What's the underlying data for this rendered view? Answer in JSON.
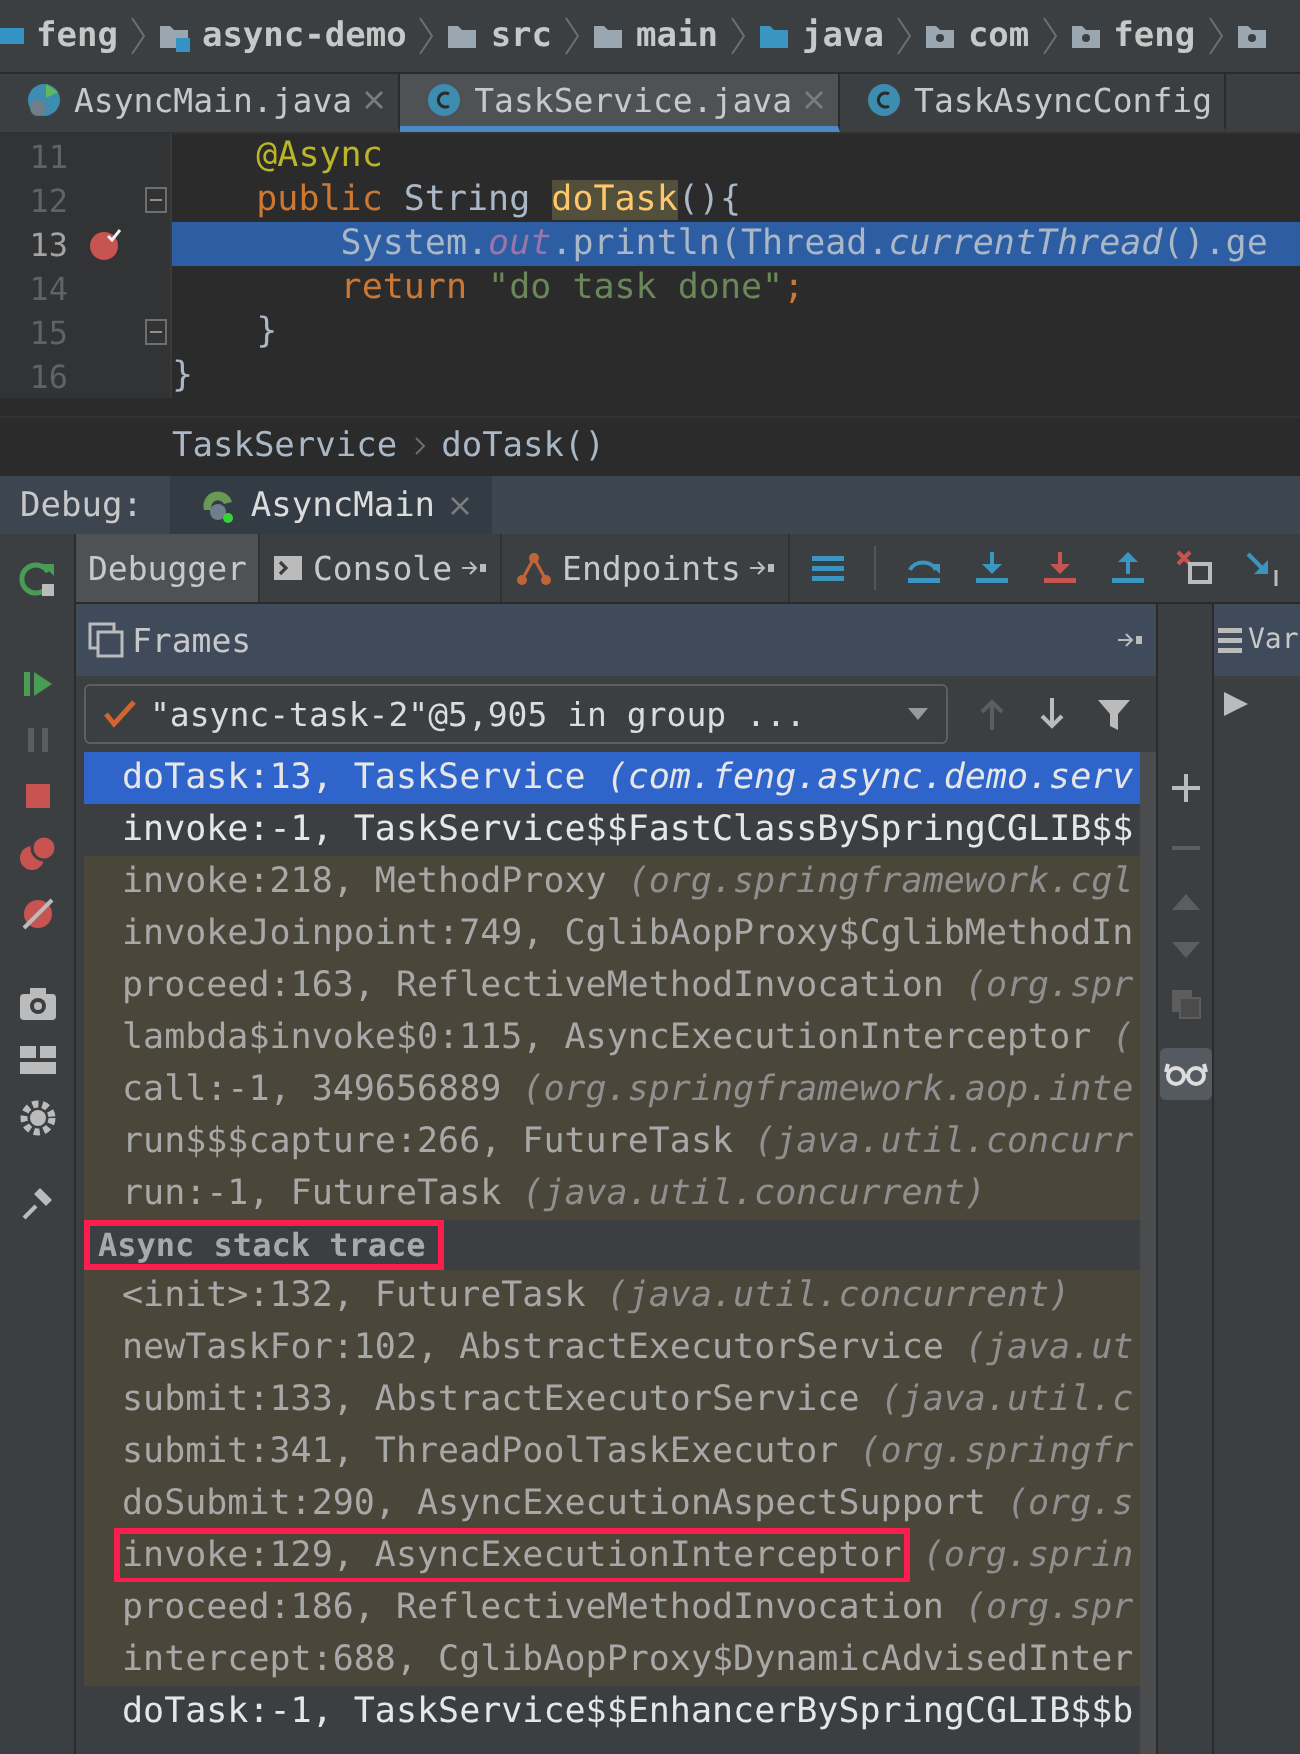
{
  "breadcrumb": [
    {
      "label": "feng",
      "kind": "module"
    },
    {
      "label": "async-demo",
      "kind": "module-folder"
    },
    {
      "label": "src",
      "kind": "folder"
    },
    {
      "label": "main",
      "kind": "folder"
    },
    {
      "label": "java",
      "kind": "source-folder"
    },
    {
      "label": "com",
      "kind": "package"
    },
    {
      "label": "feng",
      "kind": "package"
    }
  ],
  "editor_tabs": [
    {
      "label": "AsyncMain.java",
      "kind": "main-class",
      "selected": false,
      "closable": true
    },
    {
      "label": "TaskService.java",
      "kind": "class",
      "selected": true,
      "closable": true
    },
    {
      "label": "TaskAsyncConfig",
      "kind": "class",
      "selected": false,
      "closable": false
    }
  ],
  "code_lines": [
    {
      "number": "11",
      "current": false,
      "breakpoint": false,
      "fold": false,
      "tokens": [
        {
          "text": "    @Async",
          "kind": "annotation"
        }
      ]
    },
    {
      "number": "12",
      "current": false,
      "breakpoint": false,
      "fold": true,
      "tokens": [
        {
          "text": "    public",
          "kind": "keyword"
        },
        {
          "text": " String ",
          "kind": "plain"
        },
        {
          "text": "doTask",
          "kind": "usage"
        },
        {
          "text": "(){",
          "kind": "plain"
        }
      ]
    },
    {
      "number": "13",
      "current": true,
      "breakpoint": true,
      "fold": false,
      "tokens": [
        {
          "text": "        System.",
          "kind": "plain"
        },
        {
          "text": "out",
          "kind": "field"
        },
        {
          "text": ".println(Thread.",
          "kind": "plain"
        },
        {
          "text": "currentThread",
          "kind": "static"
        },
        {
          "text": "().ge",
          "kind": "plain"
        }
      ]
    },
    {
      "number": "14",
      "current": false,
      "breakpoint": false,
      "fold": false,
      "tokens": [
        {
          "text": "        return",
          "kind": "keyword"
        },
        {
          "text": " \"do task done\"",
          "kind": "string"
        },
        {
          "text": ";",
          "kind": "keyword"
        }
      ]
    },
    {
      "number": "15",
      "current": false,
      "breakpoint": false,
      "fold": true,
      "tokens": [
        {
          "text": "    }",
          "kind": "plain"
        }
      ]
    },
    {
      "number": "16",
      "current": false,
      "breakpoint": false,
      "fold": false,
      "tokens": [
        {
          "text": "}",
          "kind": "plain"
        }
      ]
    }
  ],
  "editor_breadcrumb": [
    "TaskService",
    "doTask()"
  ],
  "debug": {
    "label": "Debug:",
    "session": "AsyncMain"
  },
  "debugger_tabs": [
    {
      "label": "Debugger",
      "kind": "debugger",
      "selected": true
    },
    {
      "label": "Console",
      "kind": "console",
      "selected": false
    },
    {
      "label": "Endpoints",
      "kind": "endpoints",
      "selected": false
    }
  ],
  "frames": {
    "title": "Frames",
    "thread": "\"async-task-2\"@5,905 in group ...",
    "rows": [
      {
        "kind": "frame",
        "name": "doTask:13, TaskService",
        "package": "(com.feng.async.demo.serv",
        "library": false,
        "selected": true
      },
      {
        "kind": "frame",
        "name": "invoke:-1, TaskService$$FastClassBySpringCGLIB$$",
        "library": false,
        "selected": false
      },
      {
        "kind": "frame",
        "name": "invoke:218, MethodProxy",
        "package": "(org.springframework.cgl",
        "library": true,
        "selected": false
      },
      {
        "kind": "frame",
        "name": "invokeJoinpoint:749, CglibAopProxy$CglibMethodIn",
        "library": true,
        "selected": false
      },
      {
        "kind": "frame",
        "name": "proceed:163, ReflectiveMethodInvocation",
        "package": "(org.spr",
        "library": true,
        "selected": false
      },
      {
        "kind": "frame",
        "name": "lambda$invoke$0:115, AsyncExecutionInterceptor",
        "package": "(",
        "library": true,
        "selected": false
      },
      {
        "kind": "frame",
        "name": "call:-1, 349656889",
        "package": "(org.springframework.aop.inte",
        "library": true,
        "selected": false
      },
      {
        "kind": "frame",
        "name": "run$$$capture:266, FutureTask",
        "package": "(java.util.concurr",
        "library": true,
        "selected": false
      },
      {
        "kind": "frame",
        "name": "run:-1, FutureTask",
        "package": "(java.util.concurrent)",
        "library": true,
        "selected": false
      },
      {
        "kind": "separator",
        "name": "Async stack trace",
        "annotated": true
      },
      {
        "kind": "frame",
        "name": "<init>:132, FutureTask",
        "package": "(java.util.concurrent)",
        "library": true,
        "selected": false
      },
      {
        "kind": "frame",
        "name": "newTaskFor:102, AbstractExecutorService",
        "package": "(java.ut",
        "library": true,
        "selected": false
      },
      {
        "kind": "frame",
        "name": "submit:133, AbstractExecutorService",
        "package": "(java.util.c",
        "library": true,
        "selected": false
      },
      {
        "kind": "frame",
        "name": "submit:341, ThreadPoolTaskExecutor",
        "package": "(org.springfr",
        "library": true,
        "selected": false
      },
      {
        "kind": "frame",
        "name": "doSubmit:290, AsyncExecutionAspectSupport",
        "package": "(org.s",
        "library": true,
        "selected": false
      },
      {
        "kind": "frame",
        "name": "invoke:129, AsyncExecutionInterceptor",
        "package": "(org.sprin",
        "library": true,
        "selected": false,
        "annotated": true
      },
      {
        "kind": "frame",
        "name": "proceed:186, ReflectiveMethodInvocation",
        "package": "(org.spr",
        "library": true,
        "selected": false
      },
      {
        "kind": "frame",
        "name": "intercept:688, CglibAopProxy$DynamicAdvisedInter",
        "library": true,
        "selected": false
      },
      {
        "kind": "frame",
        "name": "doTask:-1, TaskService$$EnhancerBySpringCGLIB$$b",
        "library": false,
        "selected": false
      }
    ]
  },
  "variables": {
    "title": "Var"
  }
}
